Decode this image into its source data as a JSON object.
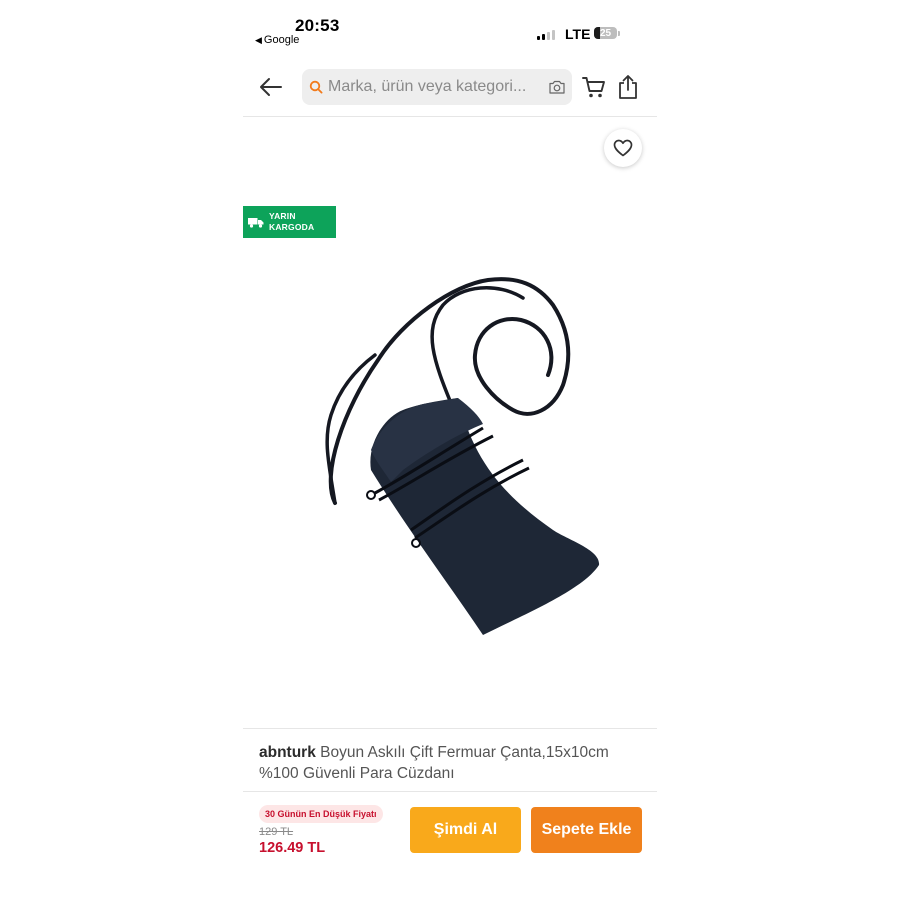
{
  "status_bar": {
    "time": "20:53",
    "back_app": "Google",
    "network": "LTE",
    "battery_level": "25",
    "battery_fraction": 0.25,
    "signal_bars_active": 2,
    "signal_bars_total": 4
  },
  "header": {
    "search_placeholder": "Marka, ürün veya kategori..."
  },
  "badge": {
    "line1": "YARIN",
    "line2": "KARGODA"
  },
  "product": {
    "brand": "abnturk",
    "name": "Boyun Askılı Çift Fermuar Çanta,15x10cm %100 Güvenli Para Cüzdanı"
  },
  "price": {
    "lowest_label": "30 Günün En Düşük Fiyatı",
    "old": "129 TL",
    "current": "126.49 TL"
  },
  "actions": {
    "buy_now": "Şimdi Al",
    "add_to_cart": "Sepete Ekle"
  },
  "colors": {
    "buy_button": "#f9a91b",
    "cart_button": "#f0811c",
    "badge_green": "#0da35a",
    "price_red": "#c7102e"
  },
  "icons": {
    "back": "arrow-left-icon",
    "search": "search-icon",
    "camera": "camera-icon",
    "cart": "cart-icon",
    "share": "share-icon",
    "favorite": "heart-icon",
    "truck": "truck-icon"
  }
}
